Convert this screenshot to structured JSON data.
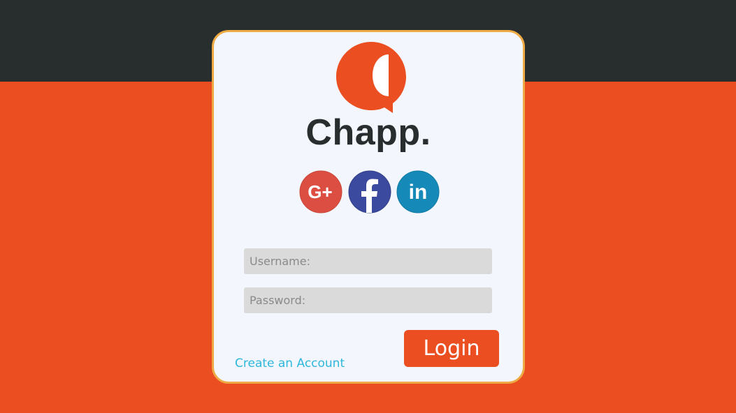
{
  "brand": {
    "name": "Chapp.",
    "icon": "chat-bubble-logo-icon"
  },
  "social": [
    {
      "name": "google-plus",
      "icon": "google-plus-icon",
      "glyph": "G+",
      "color": "#dc4e41"
    },
    {
      "name": "facebook",
      "icon": "facebook-icon",
      "glyph": "f",
      "color": "#3b4a9e"
    },
    {
      "name": "linkedin",
      "icon": "linkedin-icon",
      "glyph": "in",
      "color": "#1589b8"
    }
  ],
  "form": {
    "username_placeholder": "Username:",
    "password_placeholder": "Password:",
    "create_account_label": "Create an Account",
    "login_label": "Login"
  },
  "colors": {
    "accent": "#eb4e20",
    "dark": "#282d2e",
    "card_border": "#eeaa44",
    "card_bg": "#f3f7fd",
    "link": "#2fb6dc",
    "field_bg": "#dadada"
  }
}
